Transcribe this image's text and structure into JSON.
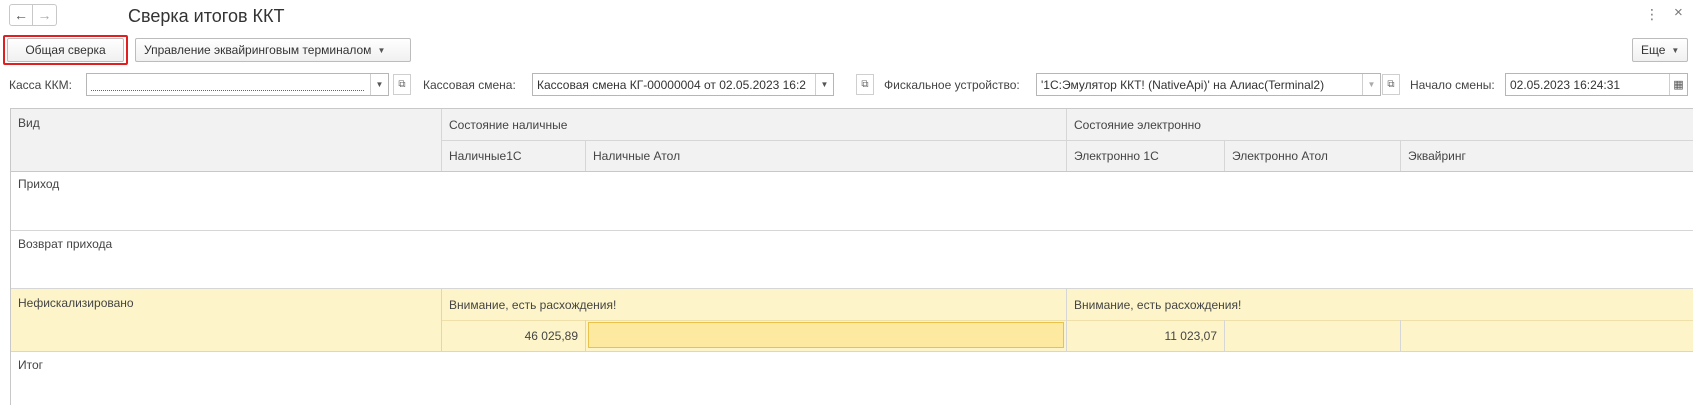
{
  "window": {
    "title": "Сверка итогов ККТ",
    "back_icon": "←",
    "forward_icon": "→",
    "more_icon": "⋮",
    "close_icon": "×"
  },
  "toolbar": {
    "general_check_label": "Общая сверка",
    "acquiring_menu_label": "Управление эквайринговым терминалом",
    "more_label": "Еще"
  },
  "filters": {
    "kassa_label": "Касса ККМ:",
    "kassa_value": "",
    "shift_label": "Кассовая смена:",
    "shift_value": "Кассовая смена КГ-00000004 от 02.05.2023 16:2",
    "fiscal_label": "Фискальное устройство:",
    "fiscal_value": "'1С:Эмулятор ККТ! (NativeApi)' на Алиас(Terminal2)",
    "start_label": "Начало смены:",
    "start_value": "02.05.2023 16:24:31"
  },
  "table": {
    "col_kind": "Вид",
    "group_cash": "Состояние наличные",
    "group_electronic": "Состояние электронно",
    "cols": {
      "cash_1c": "Наличные1С",
      "cash_atol": "Наличные Атол",
      "el_1c": "Электронно 1С",
      "el_atol": "Электронно Атол",
      "acquiring": "Эквайринг"
    },
    "rows": {
      "income": "Приход",
      "income_return": "Возврат прихода",
      "nonfiscal": "Нефискализировано",
      "nonfiscal_cash_warning": "Внимание, есть расхождения!",
      "nonfiscal_el_warning": "Внимание, есть расхождения!",
      "nonfiscal_cash_1c": "46 025,89",
      "nonfiscal_el_1c": "11 023,07",
      "total": "Итог"
    }
  },
  "colors": {
    "highlight_border": "#e02020",
    "warning_row_bg": "#fdf5c9",
    "selected_cell_bg": "#fde9a0",
    "selected_cell_border": "#e8c24a"
  }
}
